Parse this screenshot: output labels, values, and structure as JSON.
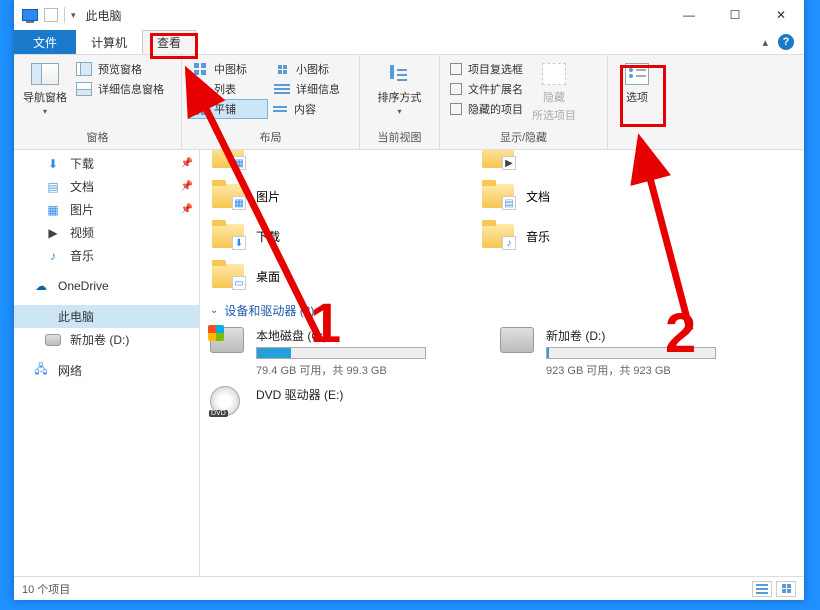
{
  "title": "此电脑",
  "tabs": {
    "file": "文件",
    "computer": "计算机",
    "view": "查看"
  },
  "ribbon": {
    "panes": {
      "nav": "导航窗格",
      "preview": "预览窗格",
      "details": "详细信息窗格",
      "group": "窗格"
    },
    "layout": {
      "medium": "中图标",
      "small": "小图标",
      "list": "列表",
      "details": "详细信息",
      "tiles": "平铺",
      "content": "内容",
      "group": "布局"
    },
    "currentview": {
      "sort": "排序方式",
      "group": "当前视图"
    },
    "showhide": {
      "chk": "项目复选框",
      "ext": "文件扩展名",
      "hidden": "隐藏的项目",
      "hidebtn1": "隐藏",
      "hidebtn2": "所选项目",
      "group": "显示/隐藏"
    },
    "options": "选项"
  },
  "sidebar": {
    "downloads": "下载",
    "documents": "文档",
    "pictures": "图片",
    "videos": "视频",
    "music": "音乐",
    "onedrive": "OneDrive",
    "thispc": "此电脑",
    "newvol": "新加卷 (D:)",
    "network": "网络"
  },
  "folders": {
    "pictures": "图片",
    "documents": "文档",
    "downloads": "下载",
    "music": "音乐",
    "desktop": "桌面"
  },
  "section": {
    "devices": "设备和驱动器 (3)"
  },
  "drives": {
    "c": {
      "name": "本地磁盘 (C:)",
      "sub": "79.4 GB 可用，共 99.3 GB",
      "fillpct": 20
    },
    "d": {
      "name": "新加卷 (D:)",
      "sub": "923 GB 可用，共 923 GB",
      "fillpct": 1
    },
    "e": {
      "name": "DVD 驱动器 (E:)"
    }
  },
  "status": "10 个项目",
  "annotations": {
    "one": "1",
    "two": "2"
  }
}
